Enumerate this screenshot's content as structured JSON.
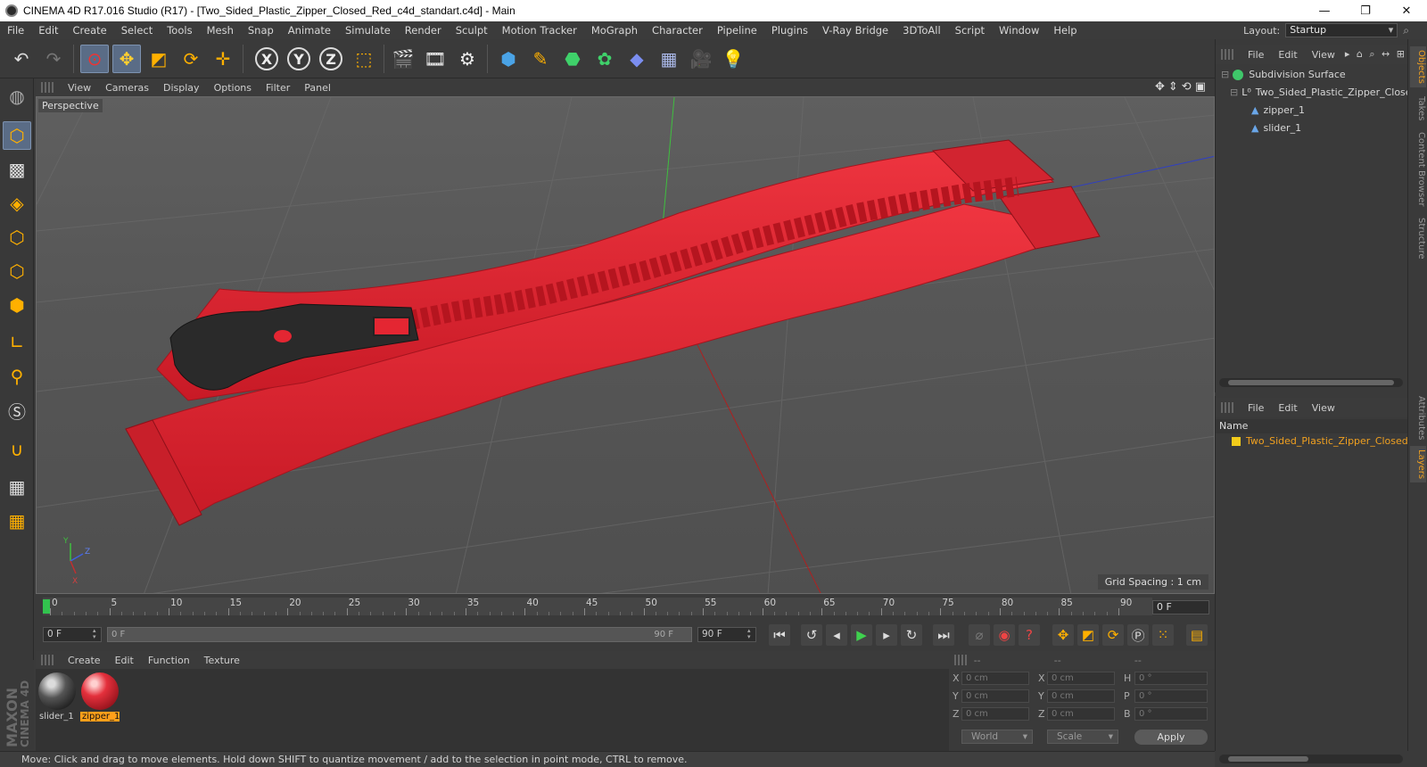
{
  "window": {
    "title": "CINEMA 4D R17.016 Studio (R17) - [Two_Sided_Plastic_Zipper_Closed_Red_c4d_standart.c4d] - Main",
    "minimize": "—",
    "maximize": "❐",
    "close": "✕"
  },
  "menubar": {
    "items": [
      "File",
      "Edit",
      "Create",
      "Select",
      "Tools",
      "Mesh",
      "Snap",
      "Animate",
      "Simulate",
      "Render",
      "Sculpt",
      "Motion Tracker",
      "MoGraph",
      "Character",
      "Pipeline",
      "Plugins",
      "V-Ray Bridge",
      "3DToAll",
      "Script",
      "Window",
      "Help"
    ],
    "layout_label": "Layout:",
    "layout_value": "Startup"
  },
  "toolbar": {
    "axis_x": "X",
    "axis_y": "Y",
    "axis_z": "Z"
  },
  "viewport": {
    "menu": [
      "View",
      "Cameras",
      "Display",
      "Options",
      "Filter",
      "Panel"
    ],
    "camera_label": "Perspective",
    "grid_spacing": "Grid Spacing : 1 cm",
    "axis_labels": {
      "x": "X",
      "y": "Y",
      "z": "Z"
    }
  },
  "timeline": {
    "ticks": [
      "0",
      "5",
      "10",
      "15",
      "20",
      "25",
      "30",
      "35",
      "40",
      "45",
      "50",
      "55",
      "60",
      "65",
      "70",
      "75",
      "80",
      "85",
      "90"
    ],
    "end_frame_field": "0 F",
    "current_frame": "0 F",
    "range_start": "0 F",
    "range_end": "90 F",
    "max_frame": "90 F"
  },
  "materials": {
    "menu": [
      "Create",
      "Edit",
      "Function",
      "Texture"
    ],
    "items": [
      {
        "name": "slider_1",
        "selected": false,
        "color": "#3a3a3a"
      },
      {
        "name": "zipper_1",
        "selected": true,
        "color": "#d8202e"
      }
    ],
    "brand_line1": "MAXON",
    "brand_line2": "CINEMA 4D"
  },
  "coordinates": {
    "header": [
      "--",
      "--",
      "--"
    ],
    "rows": [
      {
        "l1": "X",
        "v1": "0 cm",
        "l2": "X",
        "v2": "0 cm",
        "l3": "H",
        "v3": "0 °"
      },
      {
        "l1": "Y",
        "v1": "0 cm",
        "l2": "Y",
        "v2": "0 cm",
        "l3": "P",
        "v3": "0 °"
      },
      {
        "l1": "Z",
        "v1": "0 cm",
        "l2": "Z",
        "v2": "0 cm",
        "l3": "B",
        "v3": "0 °"
      }
    ],
    "mode_world": "World",
    "mode_scale": "Scale",
    "apply": "Apply"
  },
  "status": "Move: Click and drag to move elements. Hold down SHIFT to quantize movement / add to the selection in point mode, CTRL to remove.",
  "objects": {
    "menu": [
      "File",
      "Edit",
      "View"
    ],
    "tree": [
      {
        "name": "Subdivision Surface",
        "icon_color": "#3fc76a"
      },
      {
        "name": "Two_Sided_Plastic_Zipper_Closed",
        "icon_color": "#dddddd"
      },
      {
        "name": "zipper_1",
        "icon_color": "#6aa6e8"
      },
      {
        "name": "slider_1",
        "icon_color": "#6aa6e8"
      }
    ]
  },
  "layers": {
    "menu": [
      "File",
      "Edit",
      "View"
    ],
    "column_name": "Name",
    "row": "Two_Sided_Plastic_Zipper_Closed_",
    "swatch": "#f2cb1a"
  },
  "side_tabs": [
    "Objects",
    "Takes",
    "Content Browser",
    "Structure",
    "Attributes",
    "Layers"
  ],
  "colors": {
    "zipper_red": "#e42632",
    "slider_black": "#2a2a2a",
    "accent_orange": "#ff9f1a",
    "play_green": "#3fd14e"
  }
}
